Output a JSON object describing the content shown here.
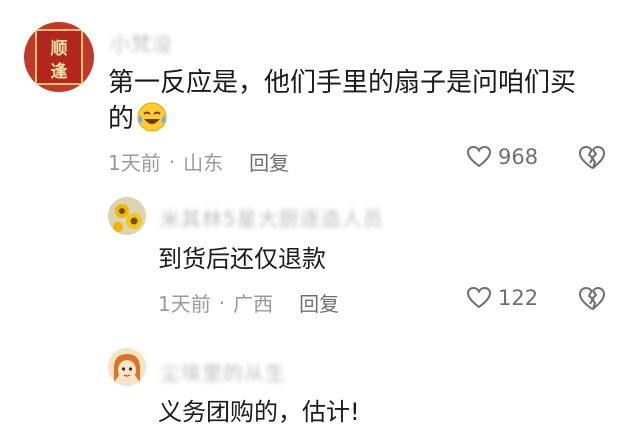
{
  "comments": [
    {
      "avatar_text": "顺逢",
      "username": "小梵没",
      "text_line1": "第一反应是，他们手里的扇子是问咱们买",
      "text_line2": "的",
      "emoji": "laughing-crying-emoji",
      "time": "1天前",
      "location": "山东",
      "reply_label": "回复",
      "likes": "968"
    },
    {
      "username": "米其林5星大厨逐造人员",
      "text": "到货后还仅退款",
      "time": "1天前",
      "location": "广西",
      "reply_label": "回复",
      "likes": "122"
    },
    {
      "username": "尘埃里的从生",
      "text": "义务团购的，估计!"
    }
  ],
  "separator": "·",
  "colors": {
    "avatar_red": "#c0392b",
    "avatar_gold": "#e8c170",
    "text": "#1a1a1a",
    "meta": "#9a9a9a"
  }
}
